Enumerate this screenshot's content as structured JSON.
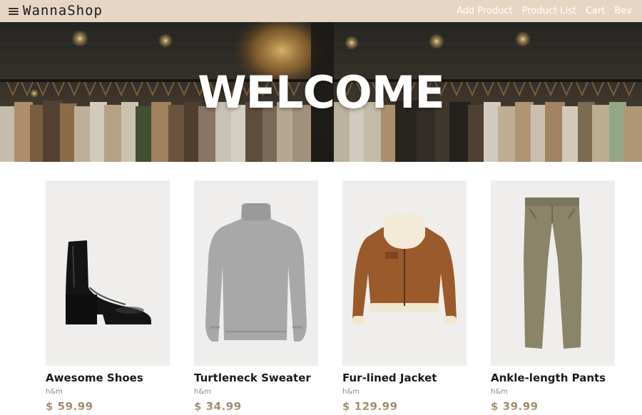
{
  "brand": {
    "name": "WannaShop",
    "menu_icon": "hamburger-menu-icon"
  },
  "nav": {
    "links": [
      {
        "label": "Add Product"
      },
      {
        "label": "Product List"
      },
      {
        "label": "Cart"
      },
      {
        "label": "Bev"
      }
    ]
  },
  "hero": {
    "title": "WELCOME"
  },
  "products": [
    {
      "name": "Awesome Shoes",
      "brand": "h&m",
      "price": "$ 59.99",
      "image": "ankle-boot-image"
    },
    {
      "name": "Turtleneck Sweater",
      "brand": "h&m",
      "price": "$ 34.99",
      "image": "turtleneck-sweater-image"
    },
    {
      "name": "Fur-lined Jacket",
      "brand": "h&m",
      "price": "$ 129.99",
      "image": "fur-lined-jacket-image"
    },
    {
      "name": "Ankle-length Pants",
      "brand": "h&m",
      "price": "$ 39.99",
      "image": "ankle-length-pants-image"
    }
  ],
  "colors": {
    "navbar": "#e7d6c4",
    "price": "#7a5a2c",
    "nav_link": "#ffffff"
  }
}
